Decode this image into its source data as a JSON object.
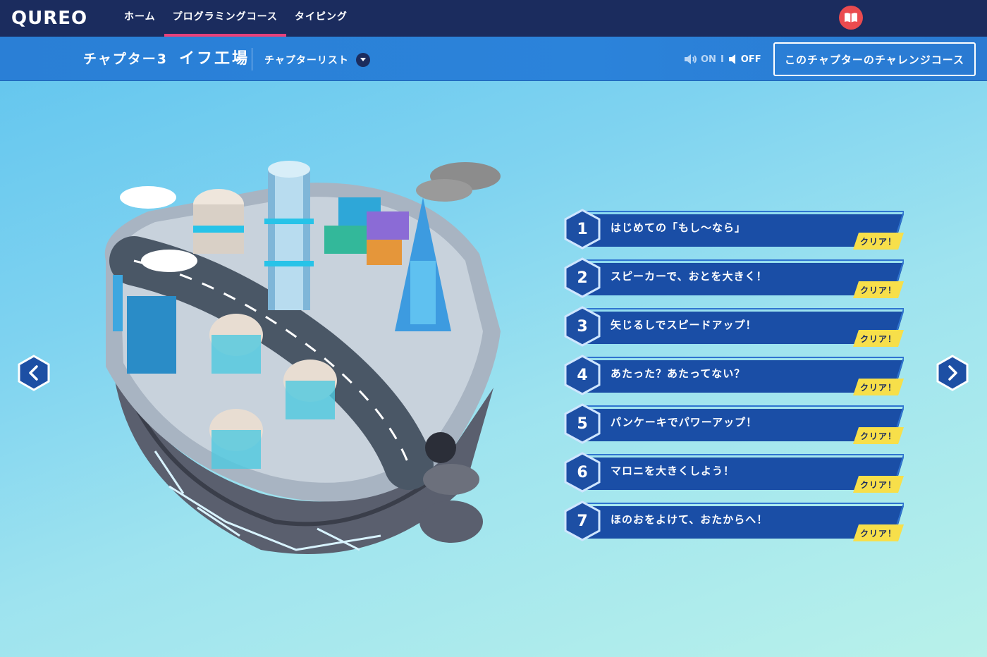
{
  "nav": {
    "logo": "QUREO",
    "items": [
      {
        "label": "ホーム",
        "active": false
      },
      {
        "label": "プログラミングコース",
        "active": true
      },
      {
        "label": "タイピング",
        "active": false
      }
    ]
  },
  "chapter": {
    "number_label": "チャプター3",
    "name": "イフ工場",
    "list_label": "チャプターリスト",
    "sound_on": "ON",
    "sound_off": "OFF",
    "sound_separator": "I",
    "challenge_label": "このチャプターのチャレンジコース"
  },
  "courses": [
    {
      "number": "1",
      "title": "はじめての「もし〜なら」",
      "status": "クリア！"
    },
    {
      "number": "2",
      "title": "スピーカーで、おとを大きく！",
      "status": "クリア！"
    },
    {
      "number": "3",
      "title": "矢じるしでスピードアップ！",
      "status": "クリア！"
    },
    {
      "number": "4",
      "title": "あたった？あたってない？",
      "status": "クリア！"
    },
    {
      "number": "5",
      "title": "パンケーキでパワーアップ！",
      "status": "クリア！"
    },
    {
      "number": "6",
      "title": "マロニを大きくしよう！",
      "status": "クリア！"
    },
    {
      "number": "7",
      "title": "ほのおをよけて、おたからへ！",
      "status": "クリア！"
    }
  ],
  "colors": {
    "nav_bg": "#1b2c5e",
    "nav_active": "#e8417a",
    "banner": "#1a4ea6",
    "clear_badge": "#f7df4a"
  },
  "icons": {
    "prev": "chevron-left-icon",
    "next": "chevron-right-icon",
    "sound_on": "speaker-on-icon",
    "sound_off": "speaker-off-icon",
    "user": "book-avatar-icon"
  }
}
